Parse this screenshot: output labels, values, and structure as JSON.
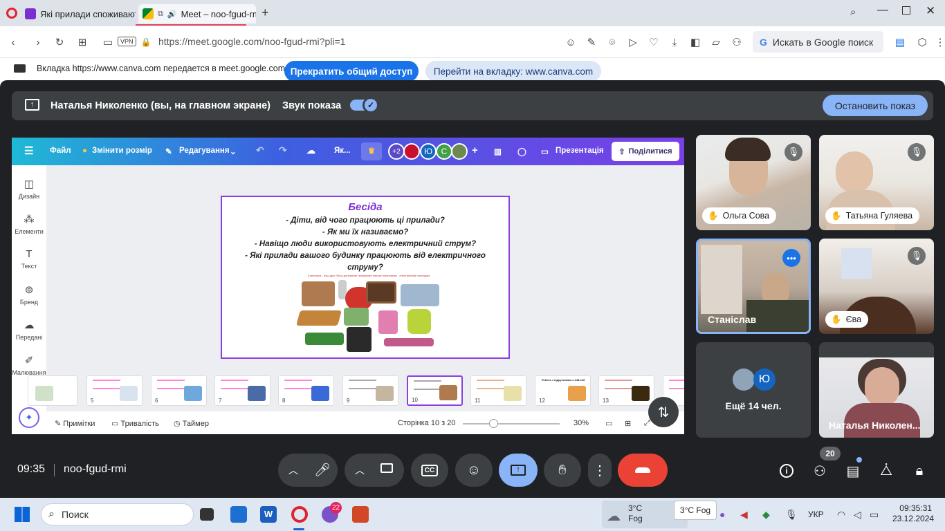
{
  "browser": {
    "tabs": [
      {
        "title": "Які прилади споживають"
      },
      {
        "title": "Meet – noo-fgud-rmi"
      }
    ],
    "new_tab": "+",
    "url": "https://meet.google.com/noo-fgud-rmi?pli=1",
    "vpn_badge": "VPN",
    "google_search": "Искать в Google поиск"
  },
  "share_banner": {
    "text": "Вкладка https://www.canva.com передается в meet.google.com",
    "stop_label": "Прекратить общий доступ",
    "goto_label": "Перейти на вкладку: www.canva.com"
  },
  "presenting": {
    "name": "Наталья Николенко (вы, на главном экране)",
    "sound_label": "Звук показа",
    "stop_label": "Остановить показ"
  },
  "canva": {
    "menu": {
      "file": "Файл",
      "resize": "Змінити розмір",
      "editing": "Редагування",
      "truncated": "Як...",
      "plus_count": "+2",
      "avatar_y": "Ю",
      "avatar_c": "С",
      "present": "Презентація",
      "share": "Поділитися"
    },
    "sidebar": [
      {
        "label": "Дизайн"
      },
      {
        "label": "Елементи"
      },
      {
        "label": "Текст"
      },
      {
        "label": "Бренд"
      },
      {
        "label": "Передані"
      },
      {
        "label": "Малювання"
      }
    ],
    "slide": {
      "title": "Бесіда",
      "questions": [
        "- Діти, від чого працюють ці прилади?",
        "- Як ми їх називаємо?",
        "- Навіщо люди використовують електричний струм?",
        "- Які прилади вашого будинку працюють від електричного",
        "струму?"
      ],
      "caption": "Електрика - наш друг. Вона допомагає працювати нашим помічникам - електричним приладам"
    },
    "thumbnails": [
      "5",
      "6",
      "7",
      "8",
      "9",
      "10",
      "11",
      "12",
      "13"
    ],
    "thumb12_title": "Робота з підручником с.148-149",
    "selected_thumb": "10",
    "bottom": {
      "notes": "Примітки",
      "duration": "Тривалість",
      "timer": "Таймер",
      "page": "Сторінка 10 з 20",
      "zoom": "30%",
      "zoom_fraction": 0.3
    }
  },
  "participants": [
    {
      "name": "Ольга Сова",
      "muted": true
    },
    {
      "name": "Татьяна Гуляева",
      "muted": true
    },
    {
      "name": "Станіслав",
      "speaking": true
    },
    {
      "name": "Єва",
      "muted": true
    },
    {
      "more": "Ещё 14 чел.",
      "avatar_letter": "Ю"
    },
    {
      "name": "Наталья Николен..."
    }
  ],
  "controls": {
    "time": "09:35",
    "meeting_code": "noo-fgud-rmi",
    "participant_count": "20"
  },
  "taskbar": {
    "search": "Поиск",
    "viber_badge": "22",
    "weather_temp": "3°C",
    "weather_desc": "Fog",
    "tooltip": "3°C Fog",
    "lang": "УКР",
    "time": "09:35:31",
    "date": "23.12.2024"
  },
  "colors": {
    "meet_bg": "#202124",
    "accent_blue": "#8ab4f8",
    "end_call_red": "#ea4335",
    "canva_purple": "#8b3ee6"
  }
}
